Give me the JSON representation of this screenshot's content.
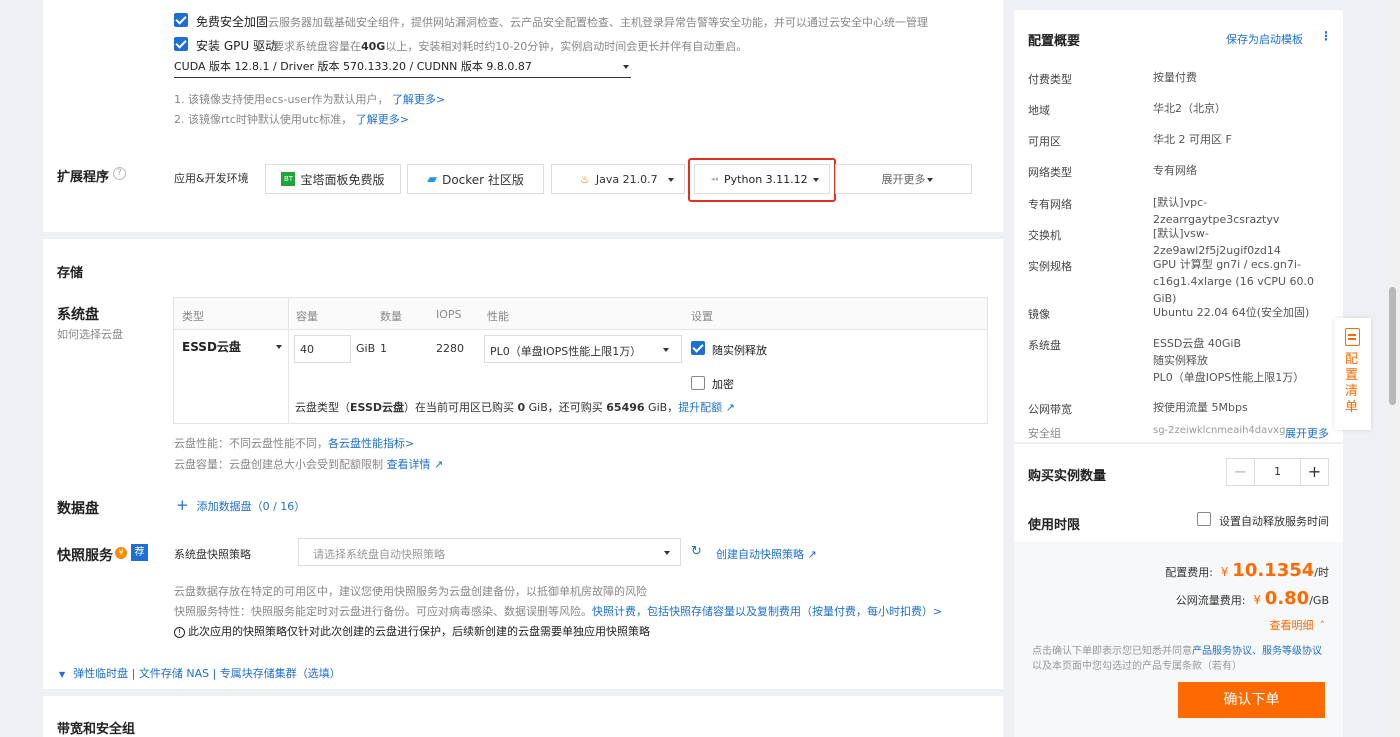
{
  "top": {
    "security": {
      "label": "免费安全加固",
      "desc": "云服务器加载基础安全组件，提供网站漏洞检查、云产品安全配置检查、主机登录异常告警等安全功能，并可以通过云安全中心统一管理"
    },
    "gpu": {
      "label": "安装 GPU 驱动",
      "desc_pre": "要求系统盘容量在",
      "desc_bold": "40G",
      "desc_post": "以上，安装相对耗时约10-20分钟，实例启动时间会更长并伴有自动重启。"
    },
    "cuda_value": "CUDA 版本 12.8.1 / Driver 版本 570.133.20 / CUDNN 版本 9.8.0.87",
    "note1_pre": "1. 该镜像支持使用ecs-user作为默认用户，",
    "note1_link": "了解更多>",
    "note2_pre": "2. 该镜像rtc时钟默认使用utc标准，",
    "note2_link": "了解更多>"
  },
  "ext": {
    "title": "扩展程序",
    "row_label": "应用&开发环境",
    "opt1": "宝塔面板免费版",
    "opt2": "Docker 社区版",
    "opt3": "Java 21.0.7",
    "opt4": "Python 3.11.12",
    "more": "展开更多"
  },
  "storage": {
    "title": "存储",
    "sys_title": "系统盘",
    "sys_sub": "如何选择云盘",
    "headers": {
      "type": "类型",
      "cap": "容量",
      "count": "数量",
      "iops": "IOPS",
      "perf": "性能",
      "settings": "设置"
    },
    "disk_type": "ESSD云盘",
    "capacity": "40",
    "unit": "GiB",
    "count": "1",
    "iops": "2280",
    "perf": "PL0（单盘IOPS性能上限1万）",
    "release": "随实例释放",
    "encrypt": "加密",
    "quota_a": "云盘类型（",
    "quota_b": "ESSD云盘",
    "quota_c": "）在当前可用区已购买 ",
    "quota_d": "0",
    "quota_e": " GiB，还可购买 ",
    "quota_f": "65496",
    "quota_g": " GiB，",
    "quota_link": "提升配额",
    "perf_note_pre": "云盘性能：不同云盘性能不同，",
    "perf_note_link": "各云盘性能指标>",
    "cap_note_pre": "云盘容量：云盘创建总大小会受到配额限制",
    "cap_note_link": "查看详情",
    "data_title": "数据盘",
    "add_data": "添加数据盘（0 / 16）",
    "snap_title": "快照服务",
    "snap_badge": "荐",
    "snap_label": "系统盘快照策略",
    "snap_placeholder": "请选择系统盘自动快照策略",
    "snap_create": "创建自动快照策略",
    "snap_note1": "云盘数据存放在特定的可用区中，建议您使用快照服务为云盘创建备份，以抵御单机房故障的风险",
    "snap_note2_pre": "快照服务特性：快照服务能定时对云盘进行备份。可应对病毒感染、数据误删等风险。",
    "snap_note2_link": "快照计费，包括快照存储容量以及复制费用（按量付费，每小时扣费）>",
    "snap_warn": "此次应用的快照策略仅针对此次创建的云盘进行保护，后续新创建的云盘需要单独应用快照策略",
    "elastic": "弹性临时盘 | 文件存储 NAS | 专属块存储集群（选填）"
  },
  "bandwidth": {
    "title": "带宽和安全组"
  },
  "summary": {
    "title": "配置概要",
    "save": "保存为启动模板",
    "rows": [
      {
        "label": "付费类型",
        "value": "按量付费"
      },
      {
        "label": "地域",
        "value": "华北2（北京）"
      },
      {
        "label": "可用区",
        "value": "华北 2 可用区 F"
      },
      {
        "label": "网络类型",
        "value": "专有网络"
      },
      {
        "label": "专有网络",
        "value": "[默认]vpc-2zearrgaytpe3csraztyv"
      },
      {
        "label": "交换机",
        "value": "[默认]vsw-2ze9awl2f5j2ugif0zd14"
      },
      {
        "label": "实例规格",
        "value": "GPU 计算型 gn7i / ecs.gn7i-c16g1.4xlarge (16 vCPU 60.0 GiB)"
      },
      {
        "label": "镜像",
        "value": "Ubuntu 22.04 64位(安全加固)"
      },
      {
        "label": "系统盘",
        "value": "ESSD云盘 40GiB\n随实例释放\nPL0（单盘IOPS性能上限1万）"
      },
      {
        "label": "公网带宽",
        "value": "按使用流量 5Mbps"
      }
    ],
    "sg_label": "安全组",
    "sg_value": "sg-2zeiwklcnmeaih4davxg",
    "sg_more": "展开更多",
    "qty_label": "购买实例数量",
    "qty_value": "1",
    "duration_label": "使用时限",
    "auto_release": "设置自动释放服务时间",
    "cfg_fee_label": "配置费用:",
    "cfg_fee_cur": "¥",
    "cfg_fee_value": "10.1354",
    "cfg_fee_unit": "/时",
    "net_fee_label": "公网流量费用:",
    "net_fee_cur": "¥",
    "net_fee_value": "0.80",
    "net_fee_unit": "/GB",
    "detail_link": "查看明细",
    "agree_pre": "点击确认下单即表示您已知悉并同意",
    "agree_link": "产品服务协议、服务等级协议",
    "agree_post": "以及本页面中您勾选过的产品专属条款（若有）",
    "confirm": "确认下单"
  },
  "side_tab": {
    "label": "配置清单"
  },
  "colors": {
    "accent": "#1d6fd6",
    "orange": "#ff6a00",
    "highlight_border": "#e0301e"
  }
}
